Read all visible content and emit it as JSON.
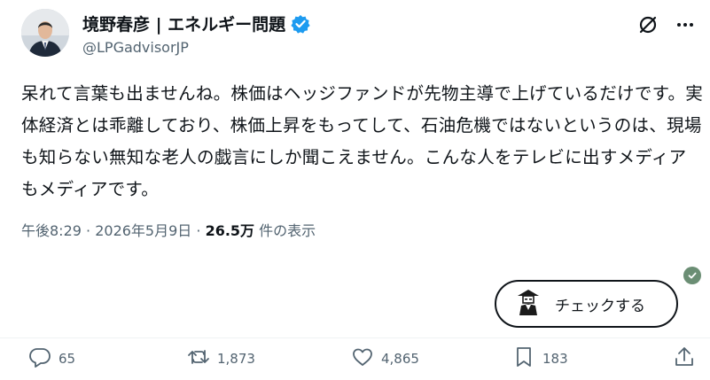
{
  "author": {
    "display_name": "境野春彦 | エネルギー問題",
    "handle": "@LPGadvisorJP",
    "verified": true
  },
  "tweet": {
    "text": "呆れて言葉も出ませんね。株価はヘッジファンドが先物主導で上げているだけです。実体経済とは乖離しており、株価上昇をもってして、石油危機ではないというのは、現場も知らない無知な老人の戯言にしか聞こえません。こんな人をテレビに出すメディアもメディアです。"
  },
  "meta": {
    "time": "午後8:29",
    "separator": " · ",
    "date": "2026年5月9日",
    "views_count": "26.5万",
    "views_label": "件の表示"
  },
  "check_button": {
    "label": "チェックする"
  },
  "actions": {
    "reply_count": "65",
    "retweet_count": "1,873",
    "like_count": "4,865",
    "bookmark_count": "183"
  },
  "colors": {
    "verified": "#1d9bf0",
    "muted": "#536471",
    "check_dot": "#6b8e74"
  }
}
